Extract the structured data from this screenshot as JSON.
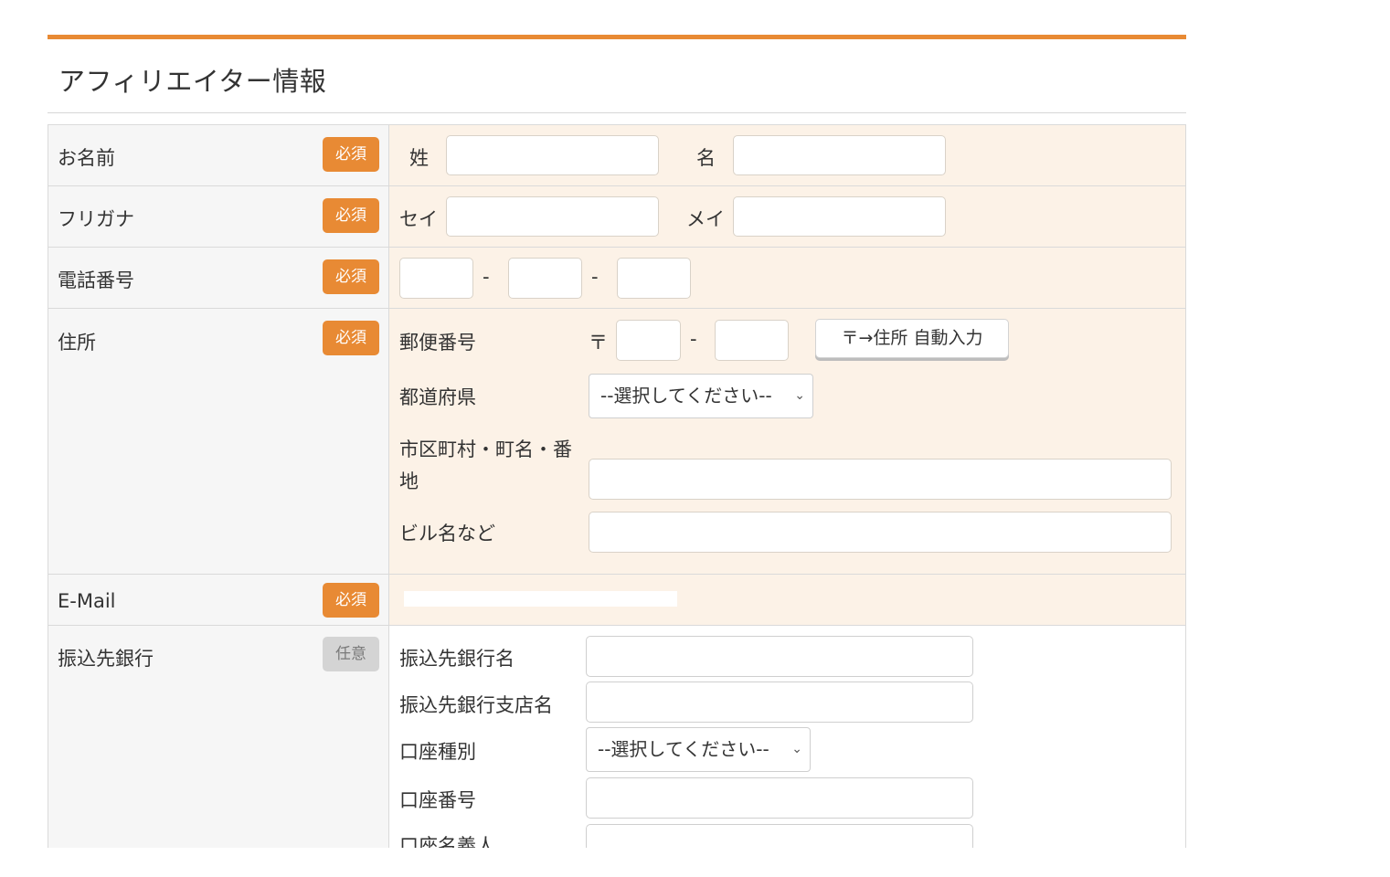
{
  "section": {
    "title": "アフィリエイター情報"
  },
  "badges": {
    "required": "必須",
    "optional": "任意"
  },
  "rows": {
    "name": {
      "label": "お名前",
      "last": "姓",
      "first": "名"
    },
    "kana": {
      "label": "フリガナ",
      "last": "セイ",
      "first": "メイ"
    },
    "phone": {
      "label": "電話番号",
      "sep": "-"
    },
    "address": {
      "label": "住所",
      "postal_label": "郵便番号",
      "postal_mark": "〒",
      "postal_sep": "-",
      "auto_button": "〒→住所 自動入力",
      "pref_label": "都道府県",
      "pref_select": "--選択してください--",
      "city_label_1": "市区町村・町名・番",
      "city_label_2": "地",
      "building_label": "ビル名など"
    },
    "email": {
      "label": "E-Mail"
    },
    "bank": {
      "label": "振込先銀行",
      "bank_name": "振込先銀行名",
      "branch_name": "振込先銀行支店名",
      "account_type": "口座種別",
      "account_type_select": "--選択してください--",
      "account_number": "口座番号",
      "account_holder": "口座名義人"
    }
  },
  "colors": {
    "accent": "#e88a34",
    "value_bg": "#fcf2e7",
    "label_bg": "#f6f6f6",
    "optional_badge": "#d4d4d4"
  }
}
